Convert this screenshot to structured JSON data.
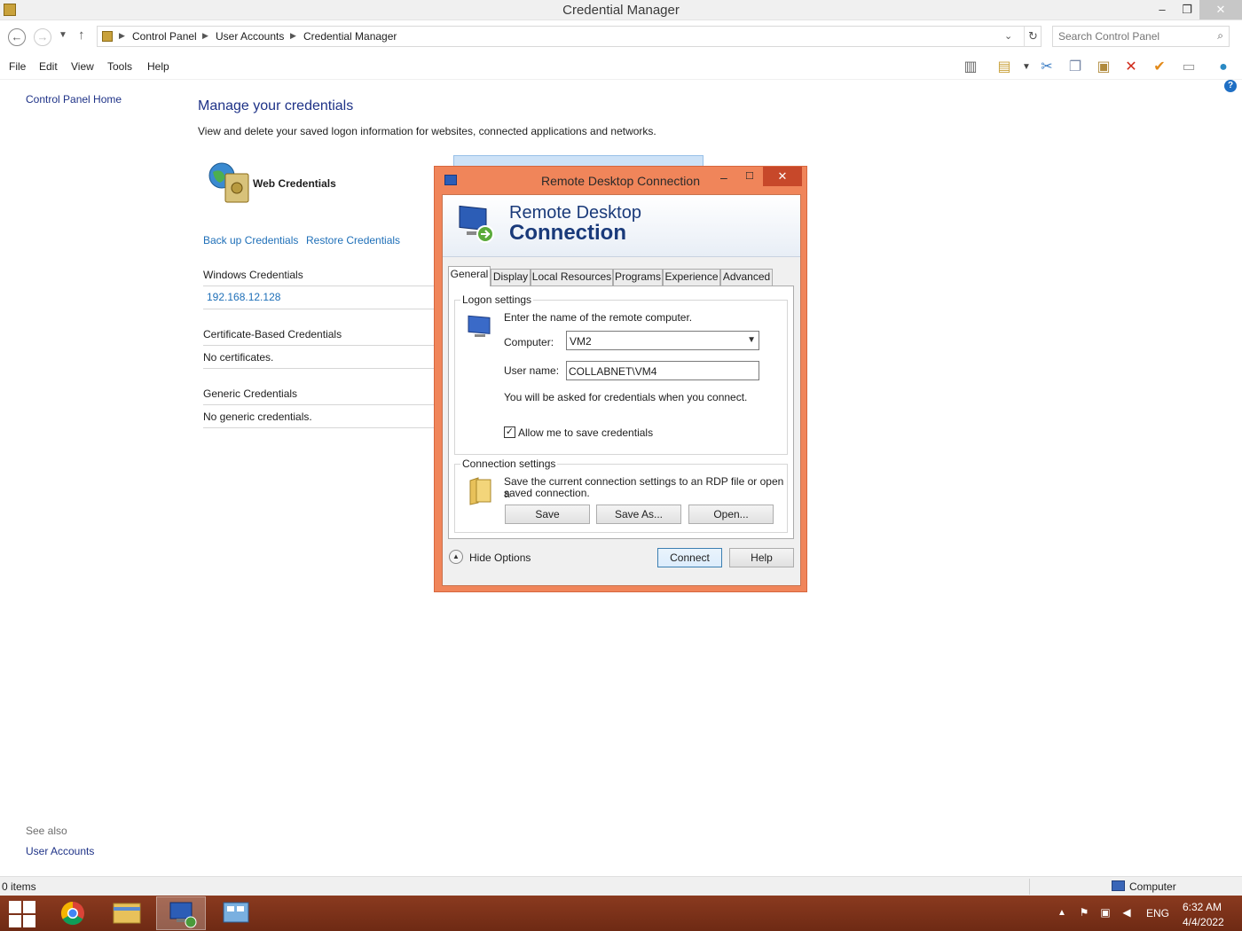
{
  "window": {
    "title": "Credential Manager",
    "min": "–",
    "max": "❐",
    "close": "✕"
  },
  "address": {
    "crumbs": [
      "Control Panel",
      "User Accounts",
      "Credential Manager"
    ],
    "search_placeholder": "Search Control Panel"
  },
  "menu": {
    "file": "File",
    "edit": "Edit",
    "view": "View",
    "tools": "Tools",
    "help": "Help"
  },
  "left": {
    "home": "Control Panel Home",
    "see_also": "See also",
    "user_accounts": "User Accounts"
  },
  "main": {
    "title": "Manage your credentials",
    "description": "View and delete your saved logon information for websites, connected applications and networks.",
    "web_credentials": "Web Credentials",
    "backup_link": "Back up Credentials",
    "restore_link": "Restore Credentials",
    "windows_credentials": {
      "heading": "Windows Credentials",
      "item": "192.168.12.128"
    },
    "certificate_credentials": {
      "heading": "Certificate-Based Credentials",
      "value": "No certificates."
    },
    "generic_credentials": {
      "heading": "Generic Credentials",
      "value": "No generic credentials."
    }
  },
  "status": {
    "items": "0 items",
    "location": "Computer"
  },
  "taskbar": {
    "lang": "ENG",
    "time": "6:32 AM",
    "date": "4/4/2022"
  },
  "rdp": {
    "title": "Remote Desktop Connection",
    "banner_line1": "Remote Desktop",
    "banner_line2": "Connection",
    "tabs": [
      "General",
      "Display",
      "Local Resources",
      "Programs",
      "Experience",
      "Advanced"
    ],
    "logon": {
      "legend": "Logon settings",
      "prompt": "Enter the name of the remote computer.",
      "computer_label": "Computer:",
      "computer_value": "VM2",
      "username_label": "User name:",
      "username_value": "COLLABNET\\VM4",
      "note": "You will be asked for credentials when you connect.",
      "allow_save": "Allow me to save credentials",
      "allow_save_checked": true
    },
    "connection": {
      "legend": "Connection settings",
      "text_line1": "Save the current connection settings to an RDP file or open a",
      "text_line2": "saved connection.",
      "save": "Save",
      "save_as": "Save As...",
      "open": "Open..."
    },
    "hide_options": "Hide Options",
    "connect": "Connect",
    "help": "Help"
  },
  "colors": {
    "accent": "#1e3287",
    "link": "#1e6fb8",
    "dialog_frame": "#f0855a",
    "taskbar": "#7a3219"
  }
}
